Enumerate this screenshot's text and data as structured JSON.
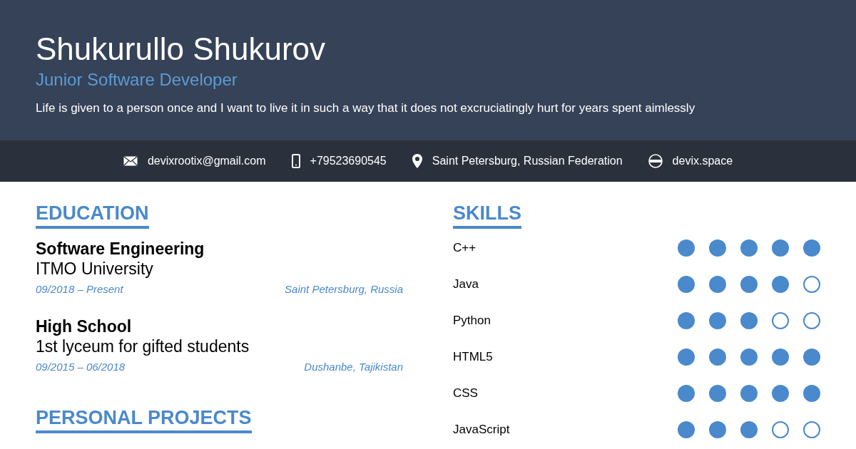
{
  "header": {
    "name": "Shukurullo Shukurov",
    "title": "Junior Software Developer",
    "motto": "Life is given to a person once and I want to live it in such a way that it does not excruciatingly hurt for years spent aimlessly"
  },
  "contacts": [
    {
      "kind": "email",
      "text": "devixrootix@gmail.com"
    },
    {
      "kind": "phone",
      "text": "+79523690545"
    },
    {
      "kind": "location",
      "text": "Saint Petersburg, Russian Federation"
    },
    {
      "kind": "web",
      "text": "devix.space"
    }
  ],
  "education": {
    "heading": "EDUCATION",
    "items": [
      {
        "degree": "Software Engineering",
        "school": "ITMO University",
        "dates": "09/2018 – Present",
        "place": "Saint Petersburg, Russia"
      },
      {
        "degree": "High School",
        "school": "1st lyceum for gifted students",
        "dates": "09/2015 – 06/2018",
        "place": "Dushanbe, Tajikistan"
      }
    ]
  },
  "projects": {
    "heading": "PERSONAL PROJECTS"
  },
  "skills": {
    "heading": "SKILLS",
    "items": [
      {
        "name": "C++",
        "stars": 5
      },
      {
        "name": "Java",
        "stars": 4
      },
      {
        "name": "Python",
        "stars": 3
      },
      {
        "name": "HTML5",
        "stars": 5
      },
      {
        "name": "CSS",
        "stars": 5
      },
      {
        "name": "JavaScript",
        "stars": 3
      }
    ]
  }
}
